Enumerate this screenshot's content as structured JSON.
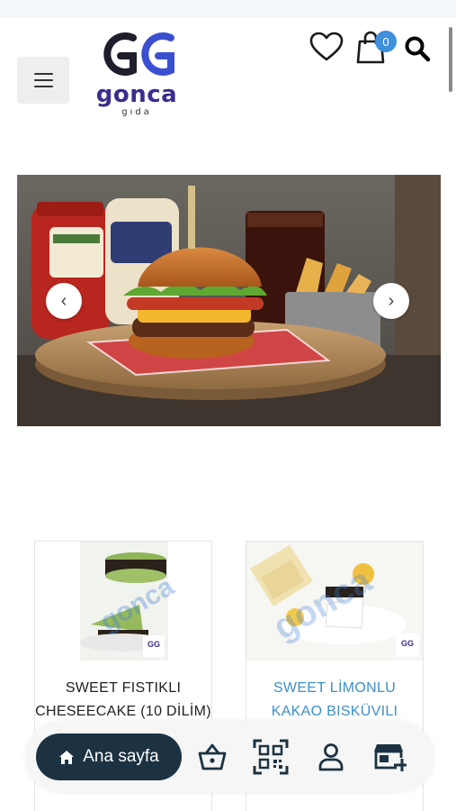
{
  "header": {
    "logo": {
      "word": "gonca",
      "sub": "gıda",
      "mark": "GG"
    },
    "cart_count": "0",
    "icons": [
      "menu-icon",
      "heart-icon",
      "cart-icon",
      "search-icon"
    ]
  },
  "slider": {
    "description_icons": [
      "chevron-left-icon",
      "chevron-right-icon"
    ],
    "prev_label": "‹",
    "next_label": "›"
  },
  "products": [
    {
      "title_line1": "SWEET FISTIKLI",
      "title_line2": "CHESEECAKE (10 DİLİM)",
      "watermark": "gonca"
    },
    {
      "title_line1": "SWEET LİMONLU",
      "title_line2": "KAKAO BISKÜVILI",
      "watermark": "gonca"
    }
  ],
  "bottom_nav": {
    "home_label": "Ana sayfa",
    "icons": [
      "home-icon",
      "basket-icon",
      "qr-code-icon",
      "user-icon",
      "store-icon"
    ]
  },
  "colors": {
    "brand_purple": "#3b2c8f",
    "accent_blue": "#3f8fdc",
    "nav_dark": "#1c3242"
  }
}
